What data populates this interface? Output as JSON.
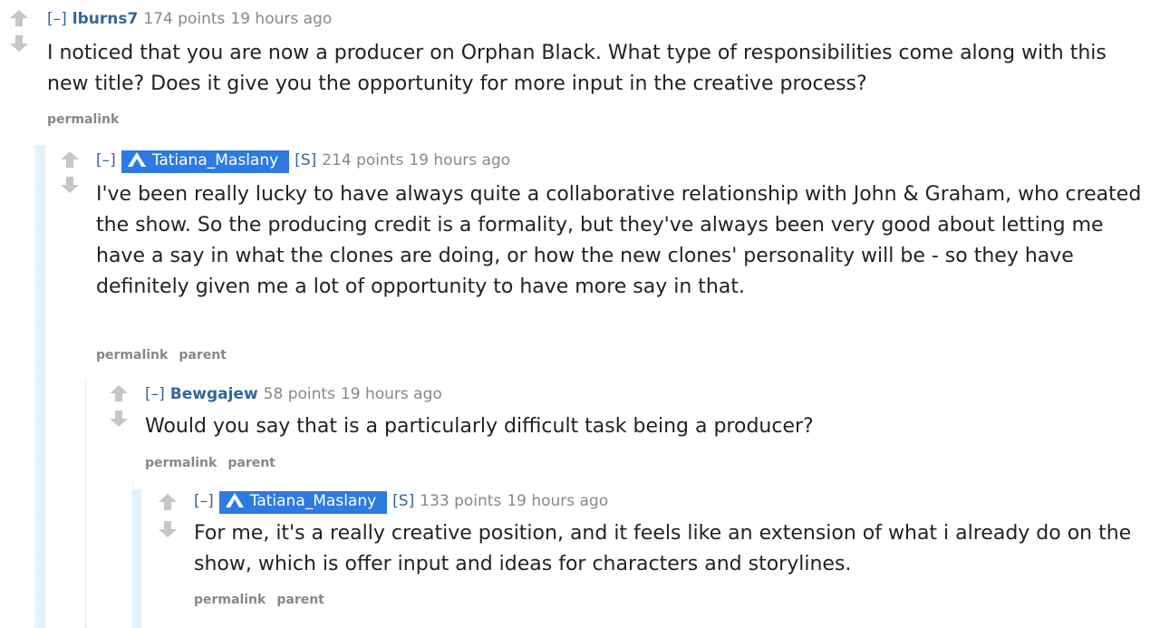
{
  "comments": [
    {
      "expand": "[–]",
      "author": "lburns7",
      "score": "174 points",
      "time": "19 hours ago",
      "body": "I noticed that you are now a producer on Orphan Black. What type of responsibilities come along with this new title? Does it give you the opportunity for more input in the creative process?",
      "buttons": {
        "permalink": "permalink"
      }
    },
    {
      "expand": "[–]",
      "author": "Tatiana_Maslany",
      "submitter": "[S]",
      "score": "214 points",
      "time": "19 hours ago",
      "body": "I've been really lucky to have always quite a collaborative relationship with John & Graham, who created the show. So the producing credit is a formality, but they've always been very good about letting me have a say in what the clones are doing, or how the new clones' personality will be - so they have definitely given me a lot of opportunity to have more say in that.",
      "buttons": {
        "permalink": "permalink",
        "parent": "parent"
      }
    },
    {
      "expand": "[–]",
      "author": "Bewgajew",
      "score": "58 points",
      "time": "19 hours ago",
      "body": "Would you say that is a particularly difficult task being a producer?",
      "buttons": {
        "permalink": "permalink",
        "parent": "parent"
      }
    },
    {
      "expand": "[–]",
      "author": "Tatiana_Maslany",
      "submitter": "[S]",
      "score": "133 points",
      "time": "19 hours ago",
      "body": "For me, it's a really creative position, and it feels like an extension of what i already do on the show, which is offer input and ideas for characters and storylines.",
      "buttons": {
        "permalink": "permalink",
        "parent": "parent"
      }
    }
  ],
  "icons": {
    "upvote": "upvote-arrow-icon",
    "downvote": "downvote-arrow-icon",
    "op_badge": "verified-logo-icon"
  },
  "colors": {
    "link": "#336699",
    "meta": "#888888",
    "op_badge": "#2d7be0",
    "op_gutter": "#e4f1f8",
    "arrow": "#c6c6c6"
  }
}
